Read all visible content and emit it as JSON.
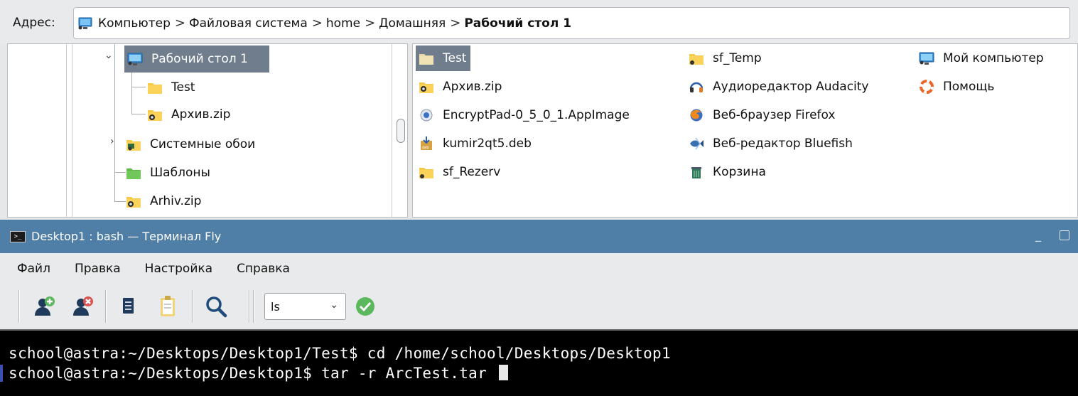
{
  "address": {
    "label": "Адрес:",
    "crumbs": [
      "Компьютер",
      "Файловая система",
      "home",
      "Домашняя",
      "Рабочий стол 1"
    ],
    "icon": "computer-icon"
  },
  "tree": {
    "items": [
      {
        "label": "Рабочий стол 1",
        "icon": "desktop-icon",
        "expanded": true,
        "selected": true
      },
      {
        "label": "Test",
        "icon": "folder-icon"
      },
      {
        "label": "Архив.zip",
        "icon": "zip-folder-icon"
      },
      {
        "label": "Системные обои",
        "icon": "wallpaper-folder-icon",
        "expandable": true
      },
      {
        "label": "Шаблоны",
        "icon": "templates-folder-icon"
      },
      {
        "label": "Arhiv.zip",
        "icon": "zip-folder-icon"
      }
    ]
  },
  "files": {
    "columns": [
      [
        {
          "label": "Test",
          "icon": "folder-icon",
          "selected": true
        },
        {
          "label": "Архив.zip",
          "icon": "zip-icon"
        },
        {
          "label": "EncryptPad-0_5_0_1.AppImage",
          "icon": "appimage-icon"
        },
        {
          "label": "kumir2qt5.deb",
          "icon": "deb-package-icon"
        },
        {
          "label": "sf_Rezerv",
          "icon": "shared-folder-icon"
        }
      ],
      [
        {
          "label": "sf_Temp",
          "icon": "shared-folder-icon"
        },
        {
          "label": "Аудиоредактор Audacity",
          "icon": "audacity-icon"
        },
        {
          "label": "Веб-браузер Firefox",
          "icon": "firefox-icon"
        },
        {
          "label": "Веб-редактор Bluefish",
          "icon": "bluefish-icon"
        },
        {
          "label": "Корзина",
          "icon": "trash-icon"
        }
      ],
      [
        {
          "label": "Мой компьютер",
          "icon": "computer-icon"
        },
        {
          "label": "Помощь",
          "icon": "help-icon"
        }
      ]
    ]
  },
  "terminal_window": {
    "title": "Desktop1 : bash — Терминал Fly",
    "icon_glyph": ">_",
    "menu": [
      "Файл",
      "Правка",
      "Настройка",
      "Справка"
    ],
    "toolbar": {
      "buttons": [
        "new-session-icon",
        "close-session-icon",
        "copy-icon",
        "paste-icon",
        "search-icon"
      ],
      "combo_value": "ls",
      "run_icon": "run-check-icon"
    },
    "lines": [
      "school@astra:~/Desktops/Desktop1/Test$ cd /home/school/Desktops/Desktop1",
      "school@astra:~/Desktops/Desktop1$ tar -r ArcTest.tar "
    ]
  },
  "colors": {
    "selection": "#6f7d8c",
    "titlebar": "#4f7ea6",
    "folder": "#f7c948",
    "terminal_bg": "#000000"
  }
}
